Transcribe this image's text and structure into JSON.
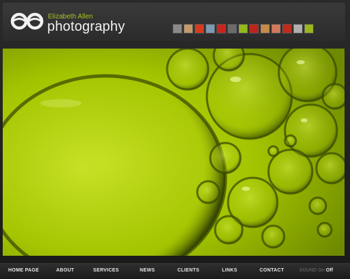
{
  "brand": {
    "name": "Elizabeth Allen",
    "tagline": "photography"
  },
  "colors": {
    "accent": "#a8c41a",
    "photo_green": "#9bc000",
    "background": "#1b1b1b"
  },
  "thumbnails": [
    {
      "label": "thumbnail-1",
      "color": "#8a8a8a"
    },
    {
      "label": "thumbnail-2",
      "color": "#c49a6c"
    },
    {
      "label": "thumbnail-3",
      "color": "#d83a1f"
    },
    {
      "label": "thumbnail-4",
      "color": "#7d99b0"
    },
    {
      "label": "thumbnail-5",
      "color": "#c8251c"
    },
    {
      "label": "thumbnail-6",
      "color": "#6b6b6b"
    },
    {
      "label": "thumbnail-7",
      "color": "#95b81e"
    },
    {
      "label": "thumbnail-8",
      "color": "#c1231a"
    },
    {
      "label": "thumbnail-9",
      "color": "#c68a4a"
    },
    {
      "label": "thumbnail-10",
      "color": "#d07a5a"
    },
    {
      "label": "thumbnail-11",
      "color": "#c22a1c"
    },
    {
      "label": "thumbnail-12",
      "color": "#b0b0b0"
    },
    {
      "label": "thumbnail-13",
      "color": "#9ab61f"
    }
  ],
  "nav": {
    "items": [
      "HOME PAGE",
      "ABOUT",
      "SERVICES",
      "NEWS",
      "CLIENTS",
      "LINKS",
      "CONTACT"
    ],
    "sound_label": "SOUND",
    "sound_on": "On",
    "sound_off": "Off"
  }
}
